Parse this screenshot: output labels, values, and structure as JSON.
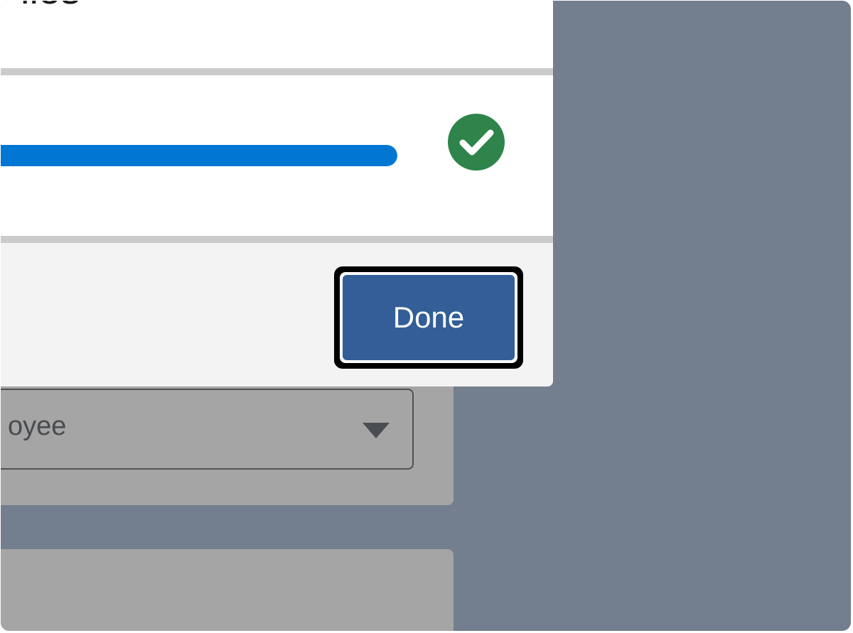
{
  "modal": {
    "title": "iles",
    "progress_percent": 100,
    "status_icon": "check-circle-icon",
    "done_label": "Done"
  },
  "background": {
    "select_value": "oyee"
  },
  "colors": {
    "backdrop": "#737f8e",
    "progress": "#0176d3",
    "success": "#2e844a",
    "button": "#335e97"
  }
}
